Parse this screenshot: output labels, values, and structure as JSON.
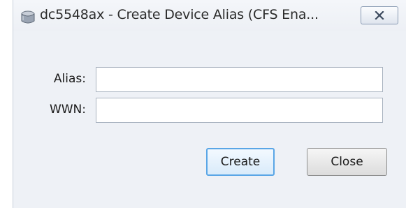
{
  "window": {
    "title": "dc5548ax - Create Device Alias (CFS Ena...",
    "app_icon": "device-icon",
    "close_icon": "close-icon"
  },
  "form": {
    "alias_label": "Alias:",
    "alias_value": "",
    "wwn_label": "WWN:",
    "wwn_value": ""
  },
  "buttons": {
    "create_label": "Create",
    "close_label": "Close"
  }
}
